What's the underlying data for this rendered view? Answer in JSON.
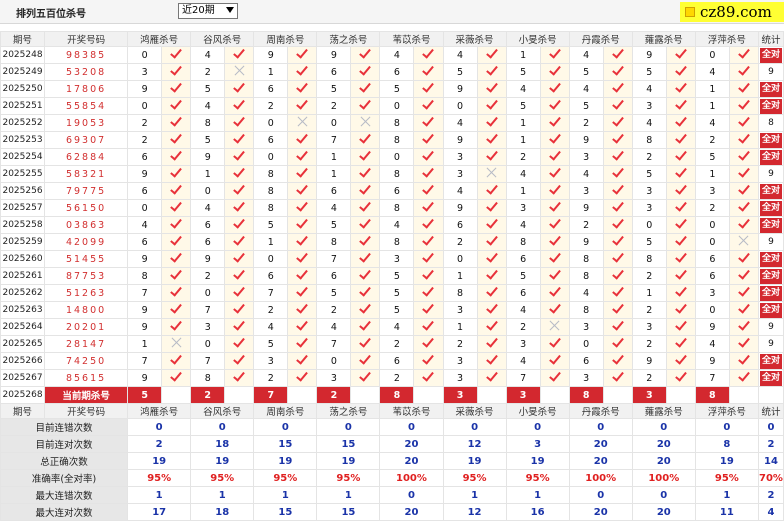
{
  "header": {
    "title": "排列五百位杀号",
    "period_select": "近20期",
    "logo_text": "cz89.com"
  },
  "columns": [
    "期号",
    "开奖号码",
    "鸿雁杀号",
    "谷风杀号",
    "周南杀号",
    "荡之杀号",
    "苇苡杀号",
    "采薇杀号",
    "小旻杀号",
    "丹霞杀号",
    "蕹露杀号",
    "浮萍杀号",
    "统计"
  ],
  "rows": [
    {
      "issue": "2025248",
      "draw": "98385",
      "kills": [
        "0",
        "4",
        "9",
        "9",
        "4",
        "4",
        "1",
        "4",
        "9",
        "0"
      ],
      "miss": [],
      "stat": "全对"
    },
    {
      "issue": "2025249",
      "draw": "53208",
      "kills": [
        "3",
        "2",
        "1",
        "6",
        "6",
        "5",
        "5",
        "5",
        "5",
        "4"
      ],
      "miss": [
        1
      ],
      "stat": "9"
    },
    {
      "issue": "2025250",
      "draw": "17806",
      "kills": [
        "9",
        "5",
        "6",
        "5",
        "5",
        "9",
        "4",
        "4",
        "4",
        "1"
      ],
      "miss": [],
      "stat": "全对"
    },
    {
      "issue": "2025251",
      "draw": "55854",
      "kills": [
        "0",
        "4",
        "2",
        "2",
        "0",
        "0",
        "5",
        "5",
        "3",
        "1"
      ],
      "miss": [],
      "stat": "全对"
    },
    {
      "issue": "2025252",
      "draw": "19053",
      "kills": [
        "2",
        "8",
        "0",
        "0",
        "8",
        "4",
        "1",
        "2",
        "4",
        "4"
      ],
      "miss": [
        2,
        3
      ],
      "stat": "8"
    },
    {
      "issue": "2025253",
      "draw": "69307",
      "kills": [
        "2",
        "5",
        "6",
        "7",
        "8",
        "9",
        "1",
        "9",
        "8",
        "2"
      ],
      "miss": [],
      "stat": "全对"
    },
    {
      "issue": "2025254",
      "draw": "62884",
      "kills": [
        "6",
        "9",
        "0",
        "1",
        "0",
        "3",
        "2",
        "3",
        "2",
        "5"
      ],
      "miss": [],
      "stat": "全对"
    },
    {
      "issue": "2025255",
      "draw": "58321",
      "kills": [
        "9",
        "1",
        "8",
        "1",
        "8",
        "3",
        "4",
        "4",
        "5",
        "1"
      ],
      "miss": [
        5
      ],
      "stat": "9"
    },
    {
      "issue": "2025256",
      "draw": "79775",
      "kills": [
        "6",
        "0",
        "8",
        "6",
        "6",
        "4",
        "1",
        "3",
        "3",
        "3"
      ],
      "miss": [],
      "stat": "全对"
    },
    {
      "issue": "2025257",
      "draw": "56150",
      "kills": [
        "0",
        "4",
        "8",
        "4",
        "8",
        "9",
        "3",
        "9",
        "3",
        "2"
      ],
      "miss": [],
      "stat": "全对"
    },
    {
      "issue": "2025258",
      "draw": "03863",
      "kills": [
        "4",
        "6",
        "5",
        "5",
        "4",
        "6",
        "4",
        "2",
        "0",
        "0"
      ],
      "miss": [],
      "stat": "全对"
    },
    {
      "issue": "2025259",
      "draw": "42099",
      "kills": [
        "6",
        "6",
        "1",
        "8",
        "8",
        "2",
        "8",
        "9",
        "5",
        "0"
      ],
      "miss": [
        9
      ],
      "stat": "9"
    },
    {
      "issue": "2025260",
      "draw": "51455",
      "kills": [
        "9",
        "9",
        "0",
        "7",
        "3",
        "0",
        "6",
        "8",
        "8",
        "6"
      ],
      "miss": [],
      "stat": "全对"
    },
    {
      "issue": "2025261",
      "draw": "87753",
      "kills": [
        "8",
        "2",
        "6",
        "6",
        "5",
        "1",
        "5",
        "8",
        "2",
        "6"
      ],
      "miss": [],
      "stat": "全对"
    },
    {
      "issue": "2025262",
      "draw": "51263",
      "kills": [
        "7",
        "0",
        "7",
        "5",
        "5",
        "8",
        "6",
        "4",
        "1",
        "3"
      ],
      "miss": [],
      "stat": "全对"
    },
    {
      "issue": "2025263",
      "draw": "14800",
      "kills": [
        "9",
        "7",
        "2",
        "2",
        "5",
        "3",
        "4",
        "8",
        "2",
        "0"
      ],
      "miss": [],
      "stat": "全对"
    },
    {
      "issue": "2025264",
      "draw": "20201",
      "kills": [
        "9",
        "3",
        "4",
        "4",
        "4",
        "1",
        "2",
        "3",
        "3",
        "9"
      ],
      "miss": [
        6
      ],
      "stat": "9"
    },
    {
      "issue": "2025265",
      "draw": "28147",
      "kills": [
        "1",
        "0",
        "5",
        "7",
        "2",
        "2",
        "3",
        "0",
        "2",
        "4"
      ],
      "miss": [
        0
      ],
      "stat": "9"
    },
    {
      "issue": "2025266",
      "draw": "74250",
      "kills": [
        "7",
        "7",
        "3",
        "0",
        "6",
        "3",
        "4",
        "6",
        "9",
        "9"
      ],
      "miss": [],
      "stat": "全对"
    },
    {
      "issue": "2025267",
      "draw": "85615",
      "kills": [
        "9",
        "8",
        "2",
        "3",
        "2",
        "3",
        "7",
        "3",
        "2",
        "7"
      ],
      "miss": [],
      "stat": "全对"
    }
  ],
  "current": {
    "issue": "2025268",
    "label": "当前期杀号",
    "kills": [
      "5",
      "2",
      "7",
      "2",
      "8",
      "3",
      "3",
      "8",
      "3",
      "8"
    ]
  },
  "stats_header": [
    "期号",
    "开奖号码",
    "鸿雁杀号",
    "谷风杀号",
    "周南杀号",
    "荡之杀号",
    "苇苡杀号",
    "采薇杀号",
    "小旻杀号",
    "丹霞杀号",
    "蕹露杀号",
    "浮萍杀号",
    "统计"
  ],
  "stats": [
    {
      "label": "目前连错次数",
      "values": [
        "0",
        "0",
        "0",
        "0",
        "0",
        "0",
        "0",
        "0",
        "0",
        "0",
        "0"
      ]
    },
    {
      "label": "目前连对次数",
      "values": [
        "2",
        "18",
        "15",
        "15",
        "20",
        "12",
        "3",
        "20",
        "20",
        "8",
        "2"
      ]
    },
    {
      "label": "总正确次数",
      "values": [
        "19",
        "19",
        "19",
        "19",
        "20",
        "19",
        "19",
        "20",
        "20",
        "19",
        "14"
      ]
    },
    {
      "label": "准确率(全对率)",
      "values": [
        "95%",
        "95%",
        "95%",
        "95%",
        "100%",
        "95%",
        "95%",
        "100%",
        "100%",
        "95%",
        "70%"
      ]
    },
    {
      "label": "最大连错次数",
      "values": [
        "1",
        "1",
        "1",
        "1",
        "0",
        "1",
        "1",
        "0",
        "0",
        "1",
        "2"
      ]
    },
    {
      "label": "最大连对次数",
      "values": [
        "17",
        "18",
        "15",
        "15",
        "20",
        "12",
        "16",
        "20",
        "20",
        "11",
        "4"
      ]
    }
  ]
}
